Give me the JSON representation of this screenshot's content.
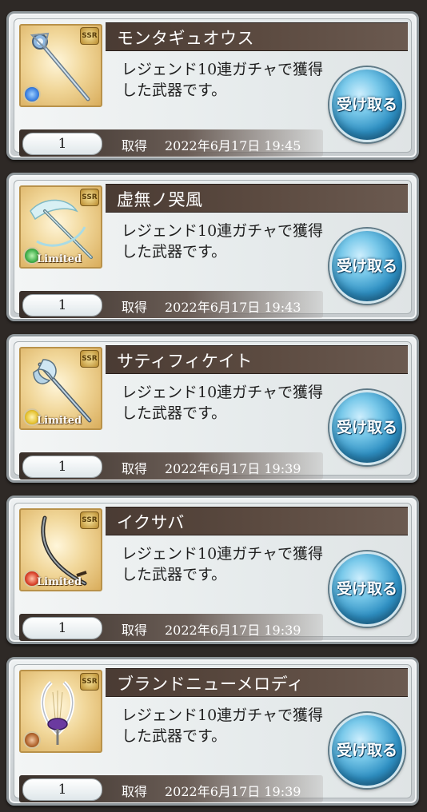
{
  "rewards": [
    {
      "name": "モンタギュオウス",
      "description": "レジェンド10連ガチャで獲得した武器です。",
      "quantity": "1",
      "acquired_label": "取得",
      "acquired_at": "2022年6月17日 19:45",
      "receive_label": "受け取る",
      "rarity": "SSR",
      "element": "water",
      "element_color": "#3a7fe0",
      "limited": false,
      "limited_label": "",
      "weapon_icon": "staff-icon"
    },
    {
      "name": "虚無ノ哭風",
      "description": "レジェンド10連ガチャで獲得した武器です。",
      "quantity": "1",
      "acquired_label": "取得",
      "acquired_at": "2022年6月17日 19:43",
      "receive_label": "受け取る",
      "rarity": "SSR",
      "element": "wind",
      "element_color": "#3fae4a",
      "limited": true,
      "limited_label": "Limited",
      "weapon_icon": "spear-icon"
    },
    {
      "name": "サティフィケイト",
      "description": "レジェンド10連ガチャで獲得した武器です。",
      "quantity": "1",
      "acquired_label": "取得",
      "acquired_at": "2022年6月17日 19:39",
      "receive_label": "受け取る",
      "rarity": "SSR",
      "element": "light",
      "element_color": "#e6c230",
      "limited": true,
      "limited_label": "Limited",
      "weapon_icon": "axe-icon"
    },
    {
      "name": "イクサバ",
      "description": "レジェンド10連ガチャで獲得した武器です。",
      "quantity": "1",
      "acquired_label": "取得",
      "acquired_at": "2022年6月17日 19:39",
      "receive_label": "受け取る",
      "rarity": "SSR",
      "element": "fire",
      "element_color": "#d9402a",
      "limited": true,
      "limited_label": "Limited",
      "weapon_icon": "katana-icon"
    },
    {
      "name": "ブランドニューメロディ",
      "description": "レジェンド10連ガチャで獲得した武器です。",
      "quantity": "1",
      "acquired_label": "取得",
      "acquired_at": "2022年6月17日 19:39",
      "receive_label": "受け取る",
      "rarity": "SSR",
      "element": "earth",
      "element_color": "#b0632c",
      "limited": false,
      "limited_label": "",
      "weapon_icon": "harp-icon"
    }
  ]
}
